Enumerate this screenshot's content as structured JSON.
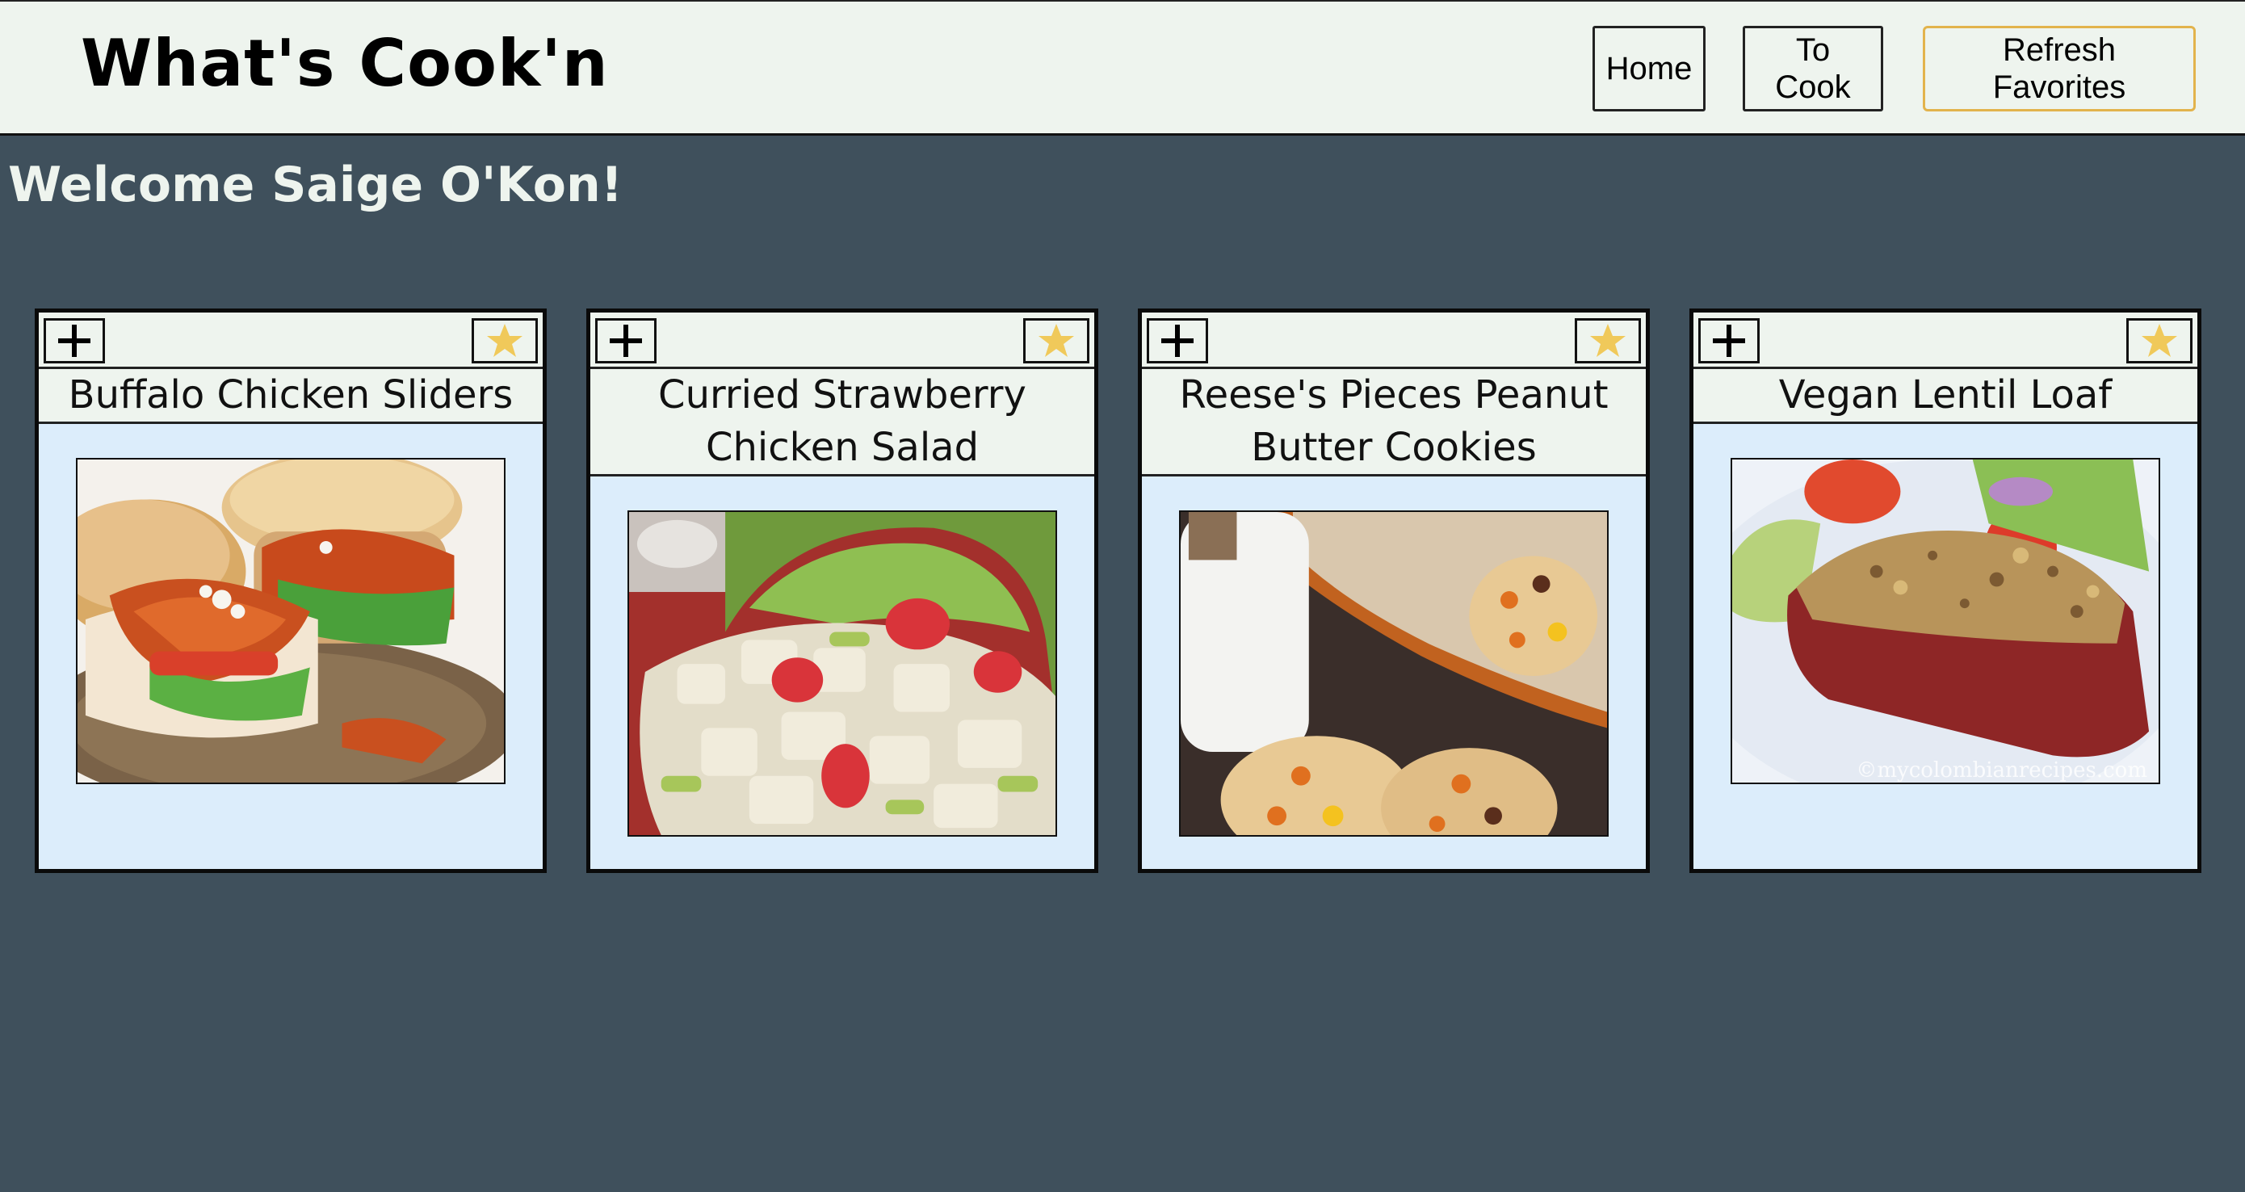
{
  "header": {
    "title": "What's Cook'n",
    "nav": {
      "home_label": "Home",
      "to_cook_label": "To\nCook",
      "refresh_label": "Refresh\nFavorites"
    }
  },
  "welcome": "Welcome Saige O'Kon!",
  "icons": {
    "add": "plus-icon",
    "favorite": "star-icon"
  },
  "colors": {
    "background": "#3f505c",
    "header_bg": "#eef4ee",
    "card_body": "#dcedfb",
    "star": "#f0c95a",
    "refresh_border": "#e2b34c"
  },
  "recipes": [
    {
      "name": "Buffalo Chicken Sliders",
      "image": "photo of buffalo chicken sliders on a plate"
    },
    {
      "name": "Curried Strawberry Chicken Salad",
      "image": "photo of chicken salad with strawberries and celery"
    },
    {
      "name": "Reese's Pieces Peanut Butter Cookies",
      "image": "photo of cookies with candy pieces on a baking sheet"
    },
    {
      "name": "Vegan Lentil Loaf",
      "image": "photo of a slice of lentil loaf with salad",
      "watermark": "©mycolombianrecipes.com"
    }
  ]
}
